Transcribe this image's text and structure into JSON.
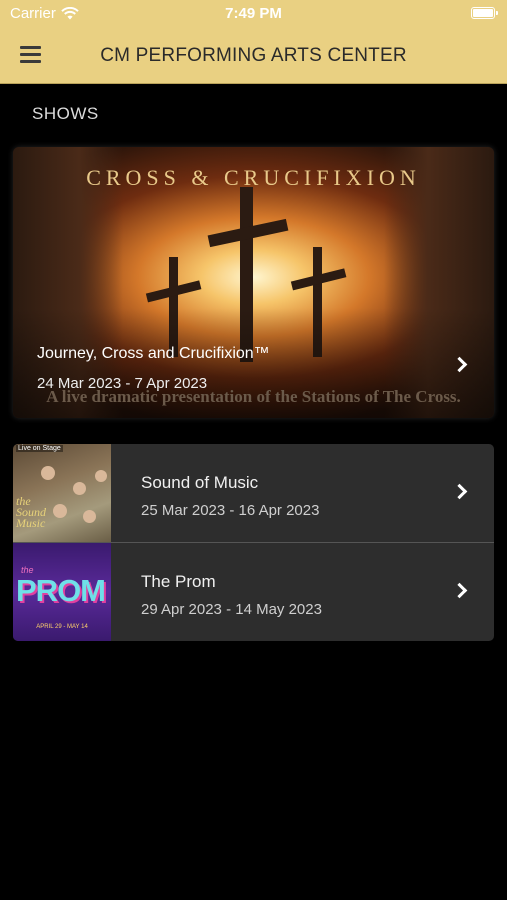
{
  "status_bar": {
    "carrier": "Carrier",
    "time": "7:49 PM"
  },
  "nav": {
    "title": "CM PERFORMING ARTS CENTER"
  },
  "section": {
    "title": "SHOWS"
  },
  "featured": {
    "banner_title": "CROSS & CRUCIFIXION",
    "tagline": "A live dramatic presentation of the Stations of The Cross.",
    "name": "Journey, Cross and Crucifixion™",
    "dates": "24 Mar 2023 - 7 Apr 2023"
  },
  "shows": [
    {
      "name": "Sound of Music",
      "dates": "25 Mar 2023 - 16 Apr 2023",
      "thumb_live": "Live on Stage",
      "thumb_logo_1": "the",
      "thumb_logo_2": "Sound",
      "thumb_logo_3": "Music"
    },
    {
      "name": "The Prom",
      "dates": "29 Apr 2023 - 14 May 2023",
      "thumb_the": "the",
      "thumb_prom": "PROM",
      "thumb_when": "APRIL 29 - MAY 14"
    }
  ],
  "colors": {
    "header_bg": "#e9d082",
    "page_bg": "#000000",
    "row_bg": "#2d2d2d"
  }
}
